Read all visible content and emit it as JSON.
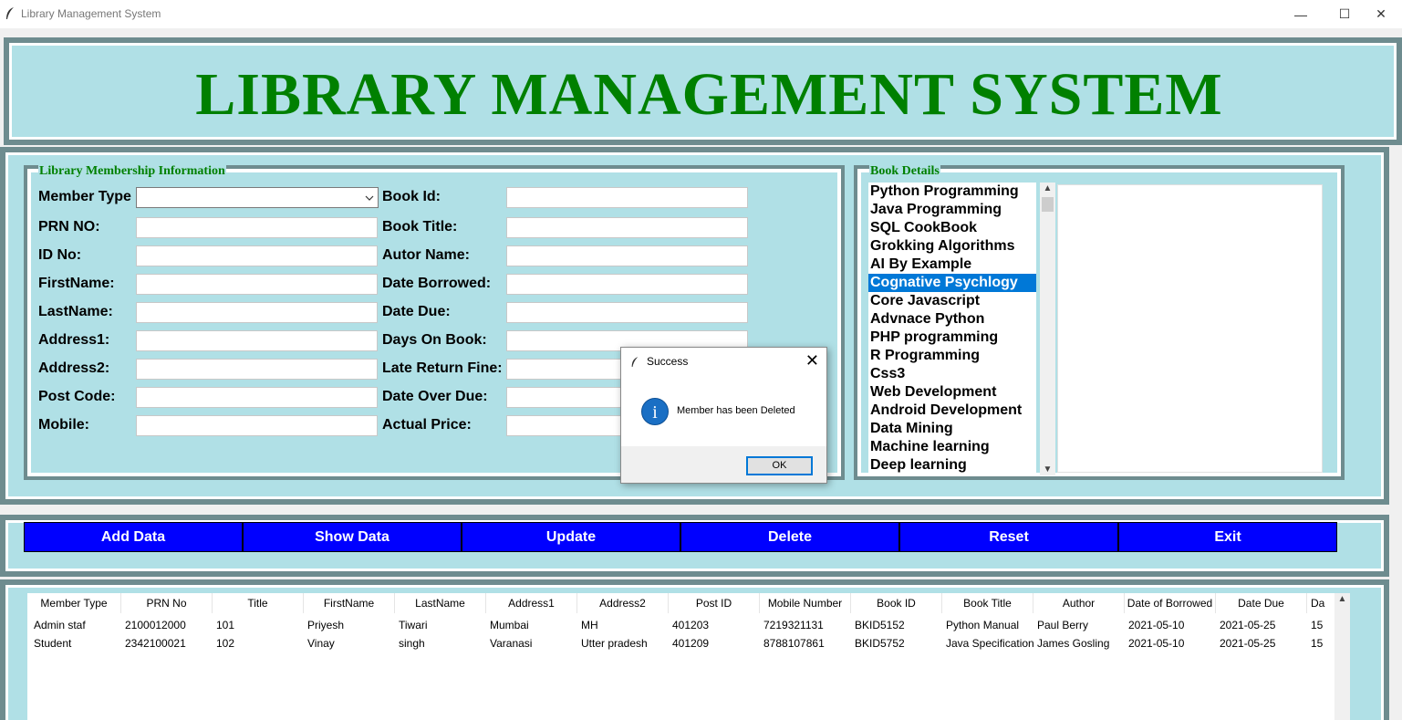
{
  "window": {
    "title": "Library Management System",
    "minimize": "—",
    "maximize": "☐",
    "close": "✕"
  },
  "header": {
    "title": "LIBRARY MANAGEMENT SYSTEM"
  },
  "membership": {
    "legend": "Library Membership Information",
    "member_type_label": "Member Type",
    "member_type_value": "",
    "fields_left": [
      {
        "label": "PRN NO:",
        "value": ""
      },
      {
        "label": "ID No:",
        "value": ""
      },
      {
        "label": "FirstName:",
        "value": ""
      },
      {
        "label": "LastName:",
        "value": ""
      },
      {
        "label": "Address1:",
        "value": ""
      },
      {
        "label": "Address2:",
        "value": ""
      },
      {
        "label": "Post Code:",
        "value": ""
      },
      {
        "label": "Mobile:",
        "value": ""
      }
    ],
    "fields_right": [
      {
        "label": "Book Id:",
        "value": ""
      },
      {
        "label": "Book Title:",
        "value": ""
      },
      {
        "label": "Autor Name:",
        "value": ""
      },
      {
        "label": "Date Borrowed:",
        "value": ""
      },
      {
        "label": "Date Due:",
        "value": ""
      },
      {
        "label": "Days On Book:",
        "value": ""
      },
      {
        "label": "Late Return Fine:",
        "value": ""
      },
      {
        "label": "Date Over Due:",
        "value": ""
      },
      {
        "label": "Actual Price:",
        "value": ""
      }
    ]
  },
  "book_details": {
    "legend": "Book Details",
    "books": [
      "Python Programming",
      "Java Programming",
      "SQL CookBook",
      "Grokking Algorithms",
      "AI By Example",
      "Cognative Psychlogy",
      "Core Javascript",
      "Advnace Python",
      "PHP programming",
      "R Programming",
      "Css3",
      "Web Development",
      "Android Development",
      "Data Mining",
      "Machine learning",
      "Deep learning"
    ],
    "selected": "Cognative Psychlogy",
    "details_text": ""
  },
  "buttons": {
    "add": "Add Data",
    "show": "Show Data",
    "update": "Update",
    "delete": "Delete",
    "reset": "Reset",
    "exit": "Exit"
  },
  "table": {
    "columns": [
      "Member Type",
      "PRN No",
      "Title",
      "FirstName",
      "LastName",
      "Address1",
      "Address2",
      "Post ID",
      "Mobile Number",
      "Book ID",
      "Book Title",
      "Author",
      "Date of Borrowed",
      "Date Due",
      "Da"
    ],
    "rows": [
      [
        "Admin staf",
        "2100012000",
        "101",
        "Priyesh",
        "Tiwari",
        "Mumbai",
        "MH",
        "401203",
        "7219321131",
        "BKID5152",
        "Python Manual",
        "Paul Berry",
        "2021-05-10",
        "2021-05-25",
        "15"
      ],
      [
        "Student",
        "2342100021",
        "102",
        "Vinay",
        "singh",
        "Varanasi",
        "Utter pradesh",
        "401209",
        "8788107861",
        "BKID5752",
        "Java Specification",
        "James Gosling",
        "2021-05-10",
        "2021-05-25",
        "15"
      ]
    ]
  },
  "dialog": {
    "title": "Success",
    "message": "Member has been Deleted",
    "ok": "OK",
    "close": "✕",
    "info_glyph": "i"
  },
  "colors": {
    "panel_bg": "#b0e0e6",
    "title_green": "#008000",
    "button_blue": "#0000ff",
    "selection_blue": "#0078d7"
  }
}
